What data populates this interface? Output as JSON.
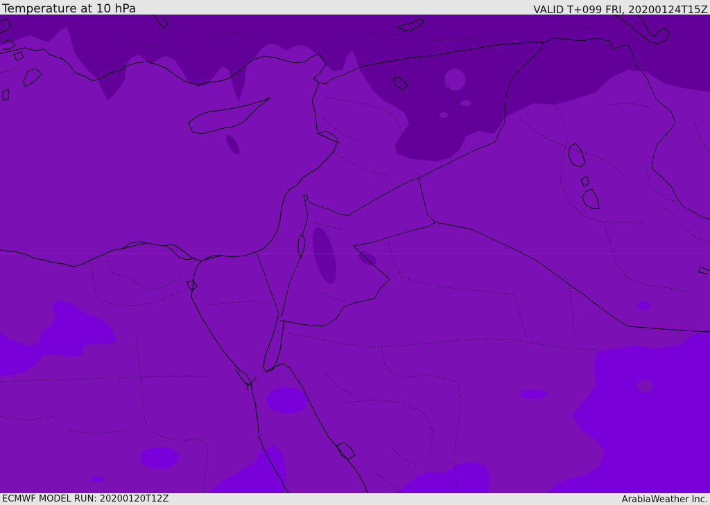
{
  "header": {
    "title": "Temperature at 10 hPa",
    "valid": "VALID T+099 FRI, 20200124T15Z"
  },
  "footer": {
    "model_run": "ECMWF MODEL RUN: 20200120T12Z",
    "credit": "ArabiaWeather Inc."
  },
  "colors": {
    "base_band": "#7b10b5",
    "cold_band": "#64009a",
    "warm_band": "#7a00da",
    "coast": "#000000",
    "border": "#000000",
    "bar_background": "#e6e6e6"
  }
}
